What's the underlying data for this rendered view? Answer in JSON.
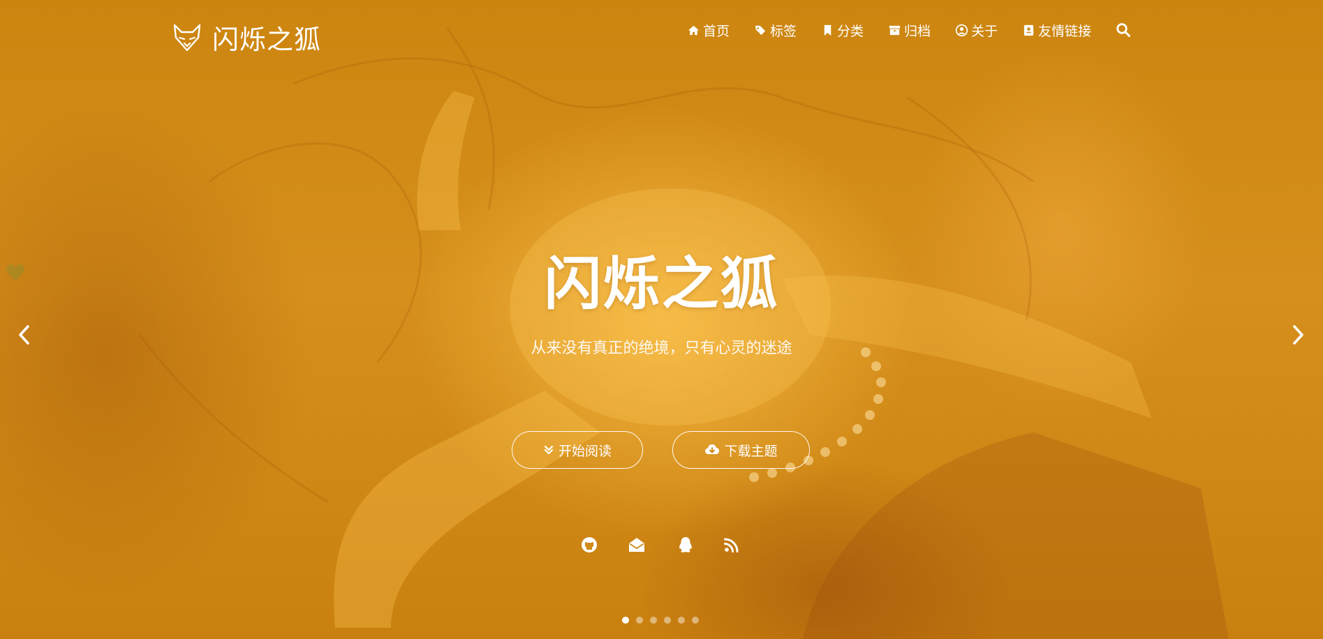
{
  "brand": {
    "name": "闪烁之狐"
  },
  "nav": {
    "items": [
      {
        "label": "首页",
        "icon": "home-icon"
      },
      {
        "label": "标签",
        "icon": "tags-icon"
      },
      {
        "label": "分类",
        "icon": "bookmark-icon"
      },
      {
        "label": "归档",
        "icon": "archive-icon"
      },
      {
        "label": "关于",
        "icon": "user-circle-icon"
      },
      {
        "label": "友情链接",
        "icon": "address-book-icon"
      }
    ],
    "search_icon": "search-icon"
  },
  "hero": {
    "title": "闪烁之狐",
    "subtitle": "从来没有真正的绝境，只有心灵的迷途",
    "buttons": {
      "read": {
        "label": "开始阅读",
        "icon": "angle-double-down-icon"
      },
      "download": {
        "label": "下载主题",
        "icon": "cloud-download-icon"
      }
    },
    "social": [
      "github-icon",
      "envelope-open-icon",
      "qq-icon",
      "rss-icon"
    ],
    "slider": {
      "slides": 6,
      "active": 1
    }
  },
  "colors": {
    "overlay": "#d68f1c",
    "text": "#ffffff"
  }
}
